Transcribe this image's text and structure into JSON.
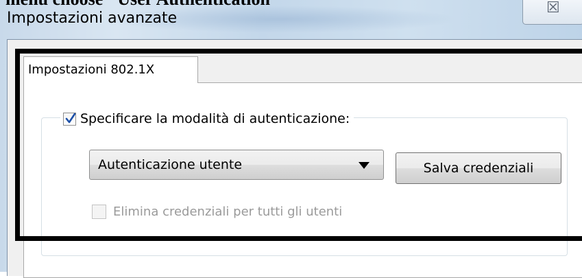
{
  "caption": "menu choose \"User Authentication\"",
  "window": {
    "title": "Impostazioni avanzate",
    "close_glyph": "☒"
  },
  "tabs": [
    {
      "label": "Impostazioni 802.1X",
      "selected": true
    }
  ],
  "group": {
    "checkbox_checked": true,
    "label": "Specificare la modalità di autenticazione:"
  },
  "auth_mode": {
    "selected": "Autenticazione utente"
  },
  "buttons": {
    "save_credentials": "Salva credenziali"
  },
  "delete_all": {
    "label": "Elimina credenziali per tutti gli utenti",
    "enabled": false,
    "checked": false
  },
  "colors": {
    "checkmark": "#1c4fa8",
    "annotation_box": "#000000"
  },
  "icons": {
    "checkbox": "checkmark-icon",
    "dropdown": "triangle-down-icon",
    "close": "close-icon"
  }
}
